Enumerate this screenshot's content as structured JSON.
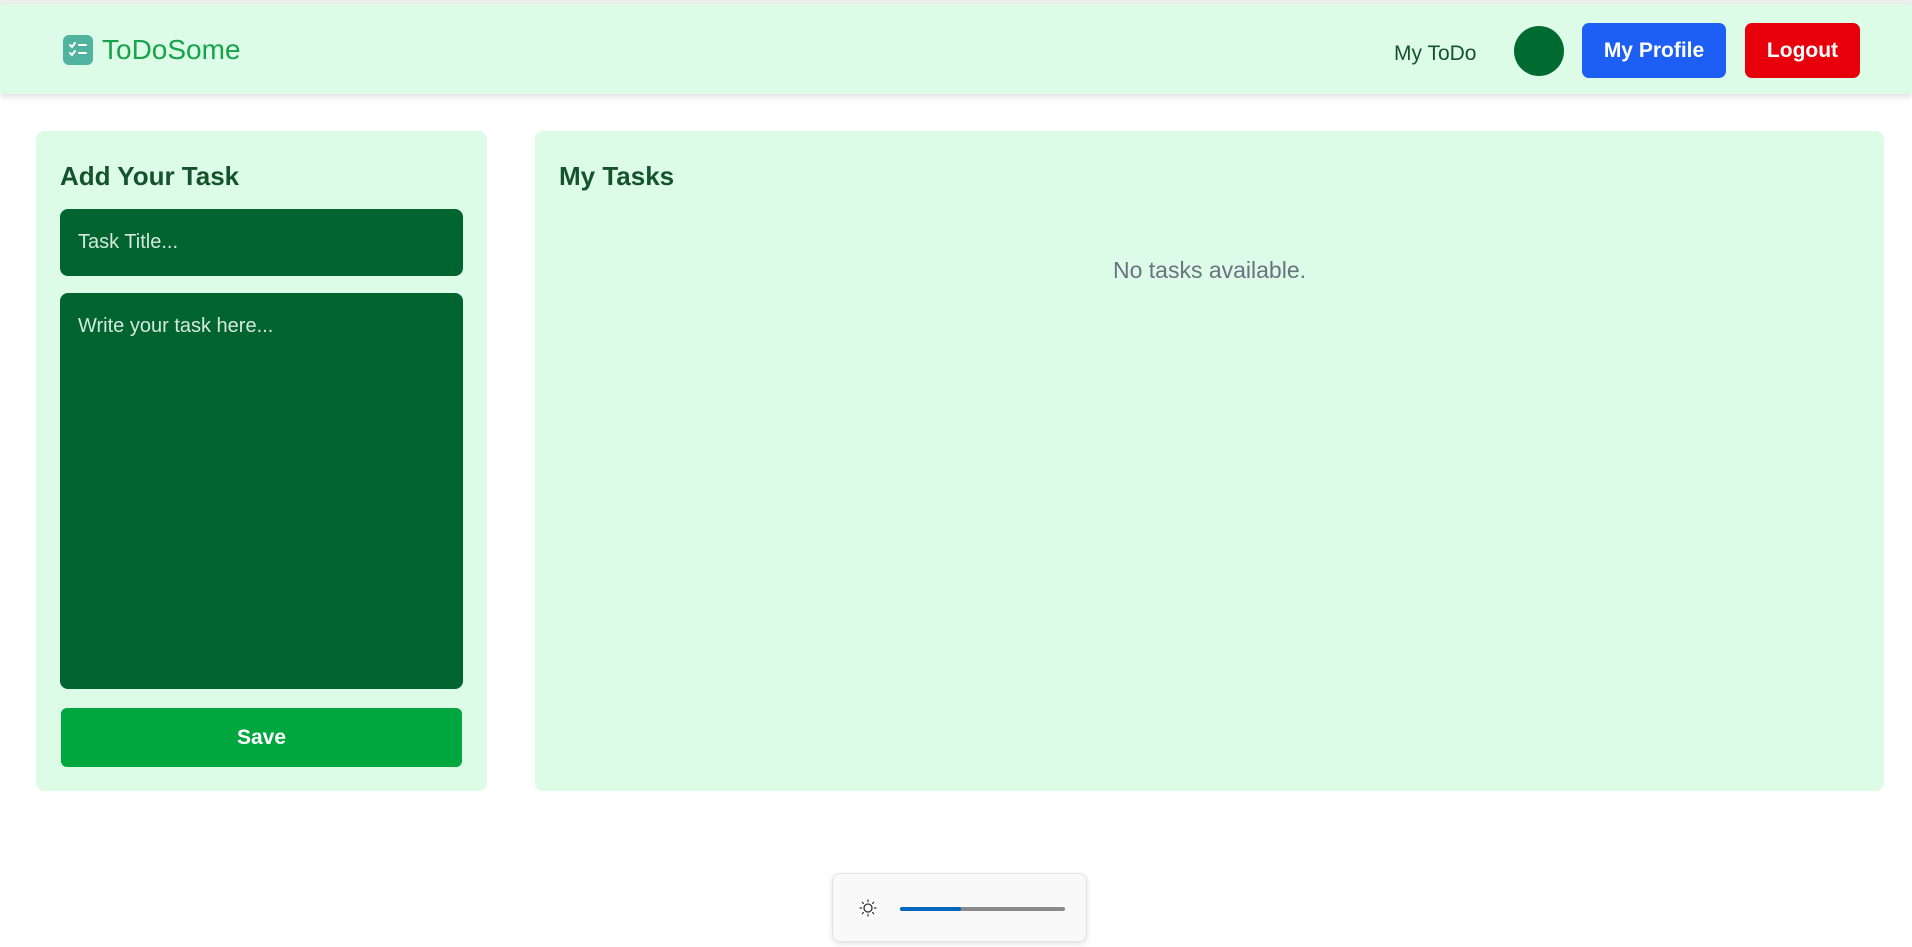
{
  "brand": {
    "name": "ToDoSome",
    "icon": "checklist-icon"
  },
  "nav": {
    "link": "My ToDo",
    "profile_button": "My Profile",
    "logout_button": "Logout"
  },
  "add_panel": {
    "title": "Add Your Task",
    "title_placeholder": "Task Title...",
    "body_placeholder": "Write your task here...",
    "save_button": "Save"
  },
  "tasks_panel": {
    "title": "My Tasks",
    "empty_message": "No tasks available."
  },
  "brightness": {
    "icon": "sun-icon",
    "level": 0.37
  },
  "colors": {
    "accent": "#16a34a",
    "panel_bg": "#dcfce7",
    "input_bg": "#006430",
    "save": "#00a63e",
    "profile": "#1d5ef5",
    "logout": "#e7000b"
  }
}
